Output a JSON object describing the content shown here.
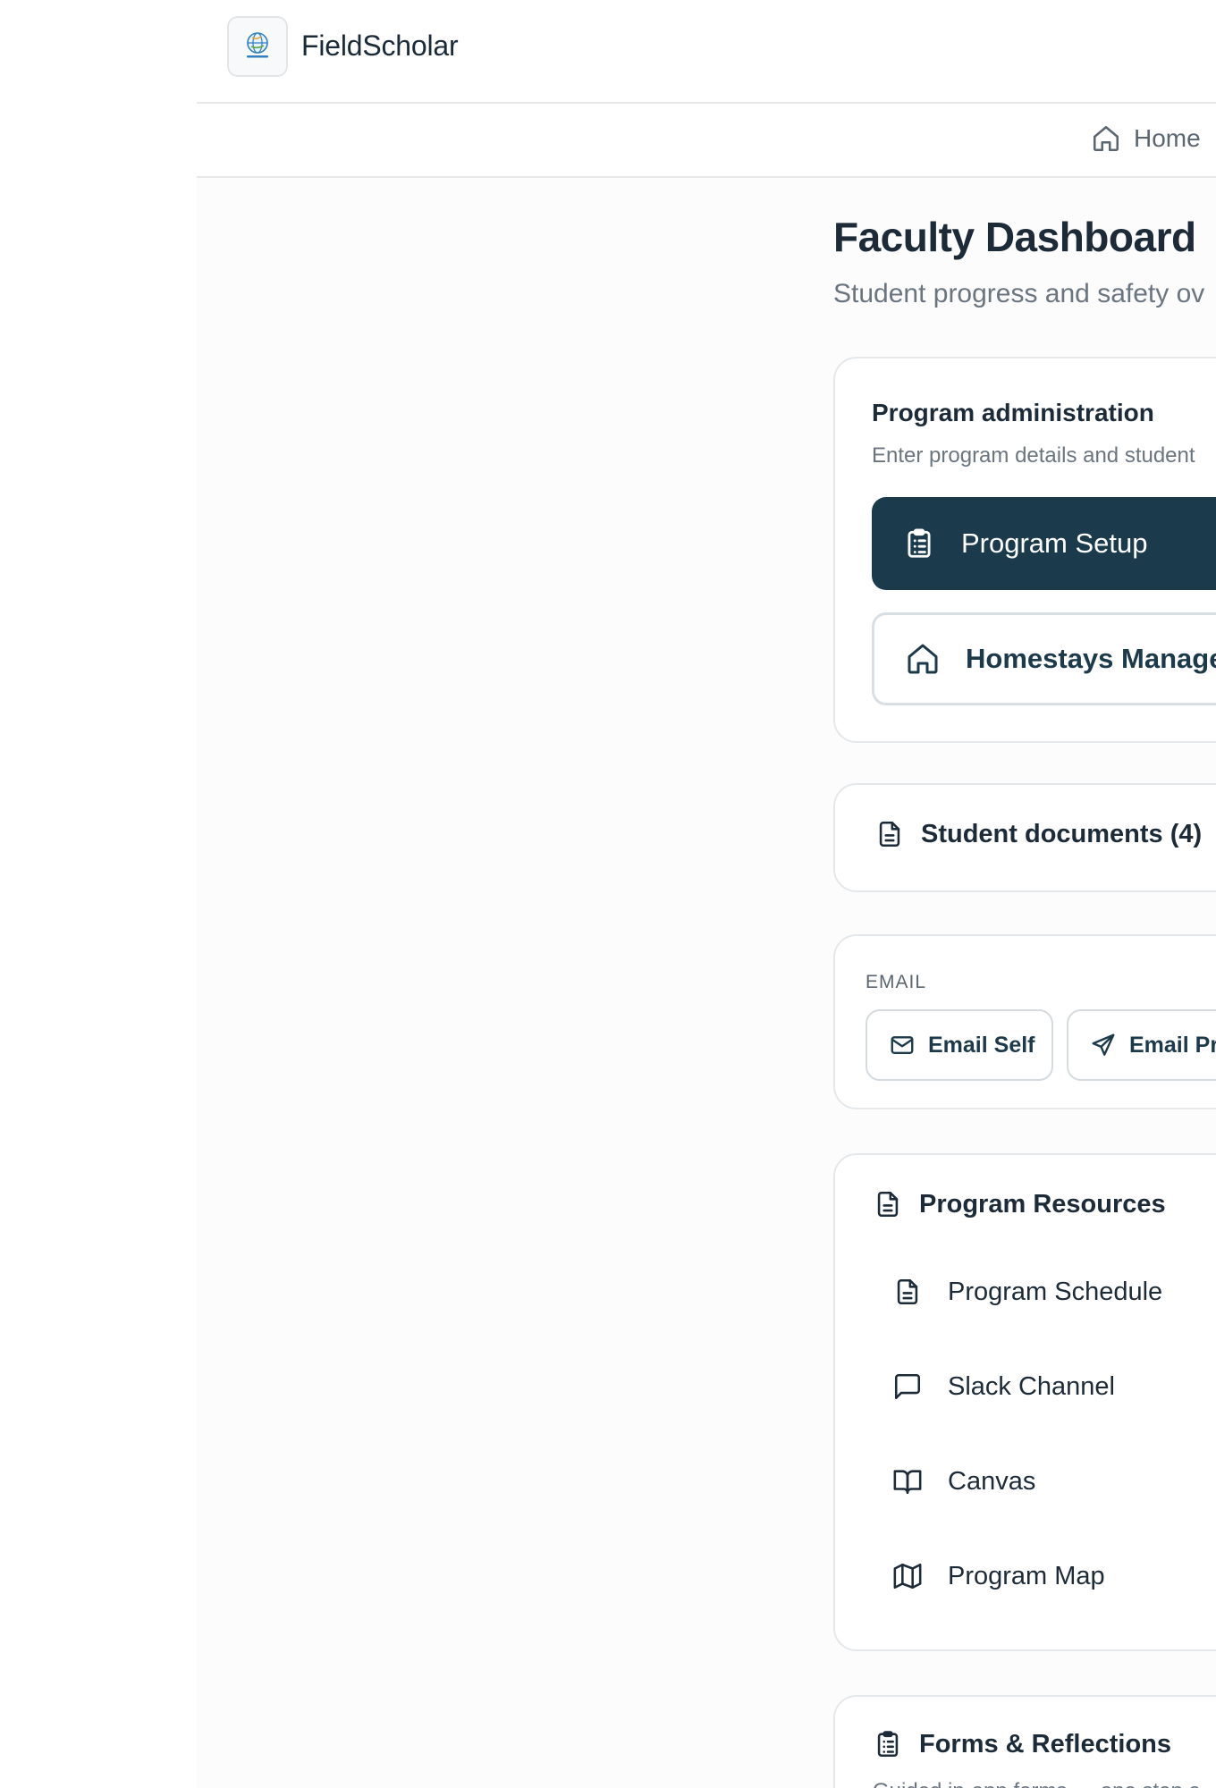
{
  "header": {
    "app_title": "FieldScholar",
    "logo_icon": "globe-logo"
  },
  "nav": {
    "home_label": "Home"
  },
  "page": {
    "title": "Faculty Dashboard",
    "subtitle": "Student progress and safety ov"
  },
  "admin": {
    "title": "Program administration",
    "subtitle": "Enter program details and student",
    "setup_label": "Program Setup",
    "homestay_label": "Homestays Manage"
  },
  "documents": {
    "label": "Student documents (4)"
  },
  "email": {
    "section_label": "EMAIL",
    "self_label": "Email Self",
    "program_label": "Email Pro"
  },
  "resources": {
    "title": "Program Resources",
    "items": [
      {
        "label": "Program Schedule",
        "icon": "document-icon"
      },
      {
        "label": "Slack Channel",
        "icon": "message-square-icon"
      },
      {
        "label": "Canvas",
        "icon": "book-open-icon"
      },
      {
        "label": "Program Map",
        "icon": "map-icon"
      }
    ]
  },
  "forms": {
    "title": "Forms & Reflections",
    "subtitle": "Guided in-app forms — one step a"
  },
  "colors": {
    "primary": "#1b3a4b",
    "text": "#1d2b39",
    "muted": "#6b7580",
    "border": "#e5e8ea"
  }
}
